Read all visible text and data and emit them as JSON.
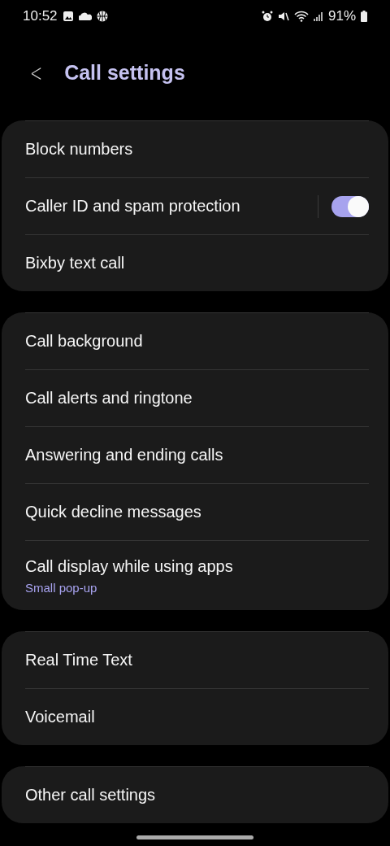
{
  "status_bar": {
    "time": "10:52",
    "battery": "91%"
  },
  "header": {
    "back": "<",
    "title": "Call settings"
  },
  "groups": [
    {
      "items": [
        {
          "label": "Block numbers"
        },
        {
          "label": "Caller ID and spam protection",
          "toggle": {
            "on": true
          }
        },
        {
          "label": "Bixby text call"
        }
      ]
    },
    {
      "items": [
        {
          "label": "Call background"
        },
        {
          "label": "Call alerts and ringtone"
        },
        {
          "label": "Answering and ending calls"
        },
        {
          "label": "Quick decline messages"
        },
        {
          "label": "Call display while using apps",
          "subtitle": "Small pop-up"
        }
      ]
    },
    {
      "items": [
        {
          "label": "Real Time Text"
        },
        {
          "label": "Voicemail"
        }
      ]
    },
    {
      "items": [
        {
          "label": "Other call settings"
        }
      ]
    }
  ]
}
